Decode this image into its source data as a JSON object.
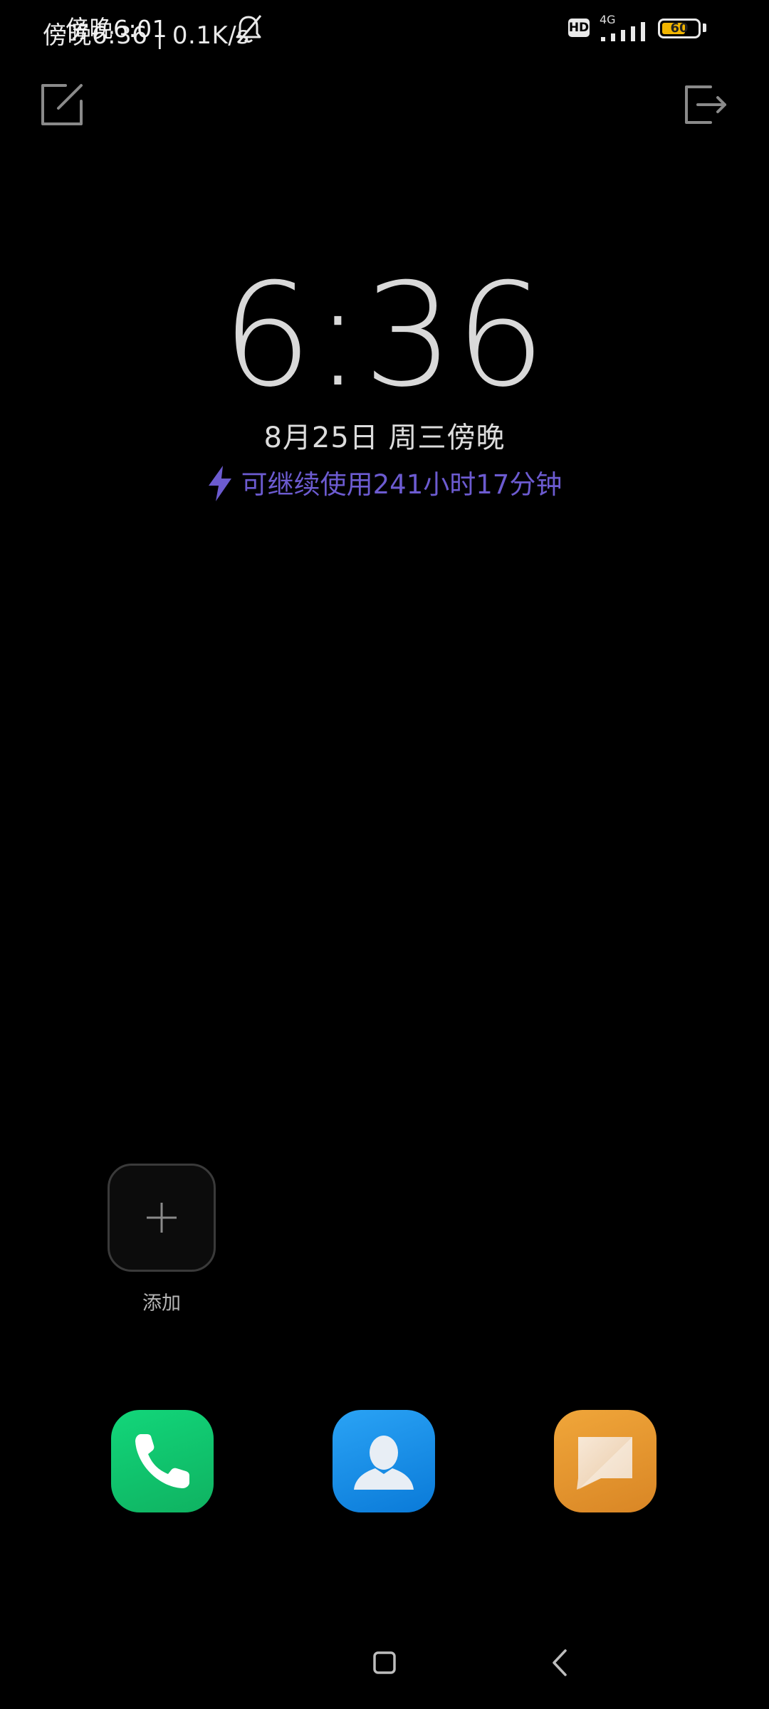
{
  "status_bar": {
    "time_and_speed": "傍晚6:36 | 0.1K/s",
    "overlay_time": "傍晚6:01",
    "hd_label": "HD",
    "network_type": "4G",
    "battery_level": "60"
  },
  "lockscreen": {
    "clock": "6:36",
    "date": "8月25日 周三傍晚",
    "battery_remaining": "可继续使用241小时17分钟"
  },
  "widget": {
    "add_label": "添加"
  },
  "dock": {
    "apps": [
      "phone-icon",
      "contacts-icon",
      "messages-icon"
    ]
  },
  "colors": {
    "battery_life_text": "#6c5bd0",
    "battery_fill": "#f1b500",
    "phone_app": "#12c46f",
    "contacts_app": "#1a8fe6",
    "messages_app": "#e69630"
  }
}
